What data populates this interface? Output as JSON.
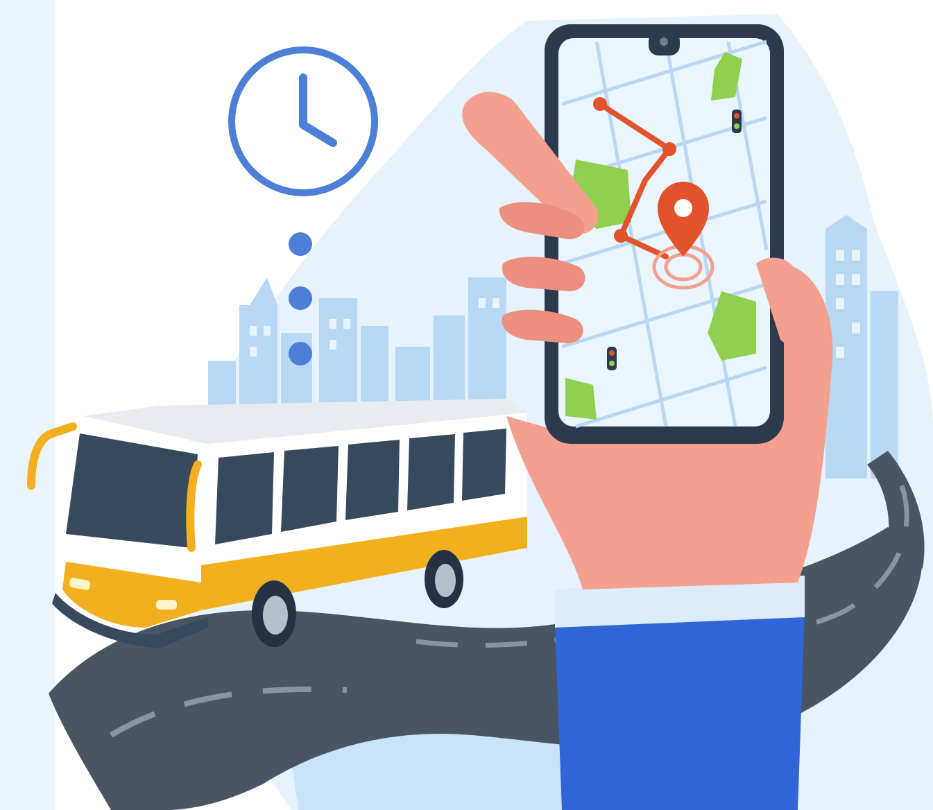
{
  "illustration": {
    "subject": "bus-tracking-app",
    "icons": [
      "clock-icon",
      "map-pin-icon",
      "traffic-light-icon",
      "bus-icon",
      "smartphone-icon"
    ],
    "colors": {
      "background_blob": "#e6f2fc",
      "city_buildings": "#b8d8f3",
      "clock_blue": "#4d7fd6",
      "road": "#4a5563",
      "bus_yellow": "#f2b01e",
      "phone_frame": "#2c3a4d",
      "map_green": "#8fd14f",
      "route_red": "#e2532c",
      "hand_skin": "#f3a08e",
      "sleeve_blue": "#3164d6"
    }
  }
}
